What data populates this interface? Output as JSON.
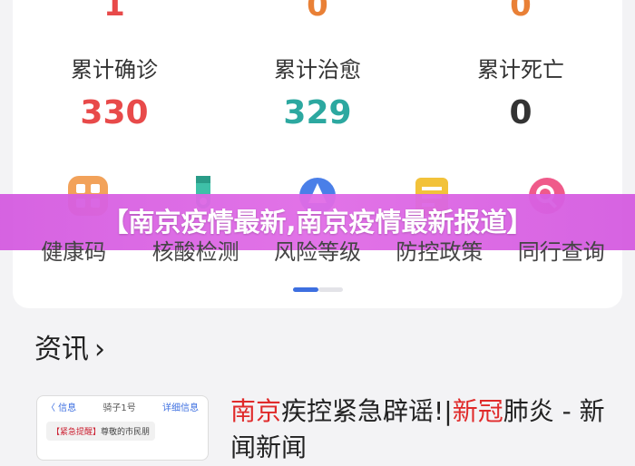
{
  "colors": {
    "confirmed": "#e84a4a",
    "recovered": "#2ca8a0",
    "dead": "#333333",
    "new_confirmed": "#e84a4a",
    "new_recovered": "#e98036",
    "new_dead": "#e98036",
    "banner": "#d45be0",
    "highlight": "#e02a2a",
    "pager_active": "#3d6fe0"
  },
  "stats_top": [
    "1",
    "0",
    "0"
  ],
  "stats": [
    {
      "label": "累计确诊",
      "value": "330"
    },
    {
      "label": "累计治愈",
      "value": "329"
    },
    {
      "label": "累计死亡",
      "value": "0"
    }
  ],
  "banner_title": "【南京疫情最新,南京疫情最新报道】",
  "services": [
    {
      "label": "健康码",
      "icon": "health-code-icon"
    },
    {
      "label": "核酸检测",
      "icon": "test-tube-icon"
    },
    {
      "label": "风险等级",
      "icon": "risk-level-icon"
    },
    {
      "label": "防控政策",
      "icon": "policy-document-icon"
    },
    {
      "label": "同行查询",
      "icon": "companion-search-icon"
    }
  ],
  "news_section": {
    "title": "资讯"
  },
  "news": {
    "title_part1": "南京",
    "title_part2": "疾控紧急辟谣!|",
    "title_part3": "新冠",
    "title_part4": "肺炎 - 新",
    "title_line2": "闻新闻",
    "thumb_back": "〈 信息",
    "thumb_name": "骑子1号",
    "thumb_detail": "详细信息",
    "thumb_tag": "【紧急提醒】",
    "thumb_msg": "尊敬的市民朋"
  }
}
